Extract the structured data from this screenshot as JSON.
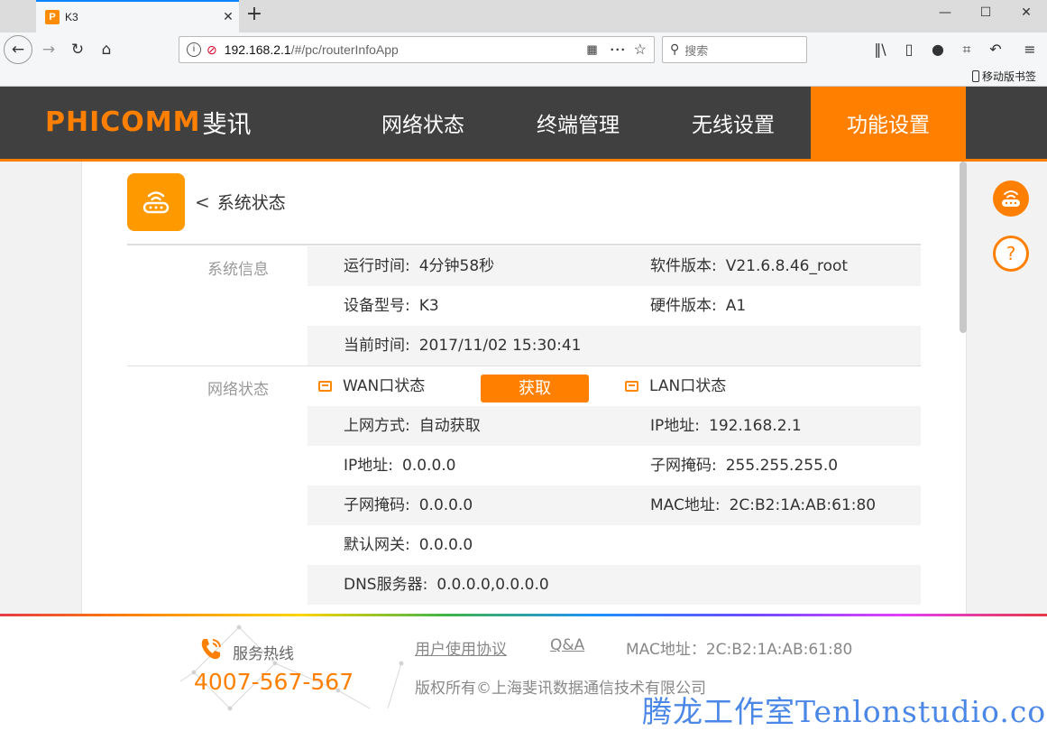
{
  "browser": {
    "tab_title": "K3",
    "tab_favicon": "P",
    "url_host": "192.168.2.1",
    "url_path": "/#/pc/routerInfoApp",
    "search_placeholder": "搜索",
    "bookmark_label": "移动版书签"
  },
  "header": {
    "logo_brand": "PHICOMM",
    "logo_cn": "斐讯",
    "nav": [
      "网络状态",
      "终端管理",
      "无线设置",
      "功能设置"
    ],
    "active_nav": "功能设置"
  },
  "page": {
    "back_title": "系统状态",
    "fetch_button": "获取"
  },
  "system_info": {
    "label": "系统信息",
    "uptime_k": "运行时间:",
    "uptime_v": "4分钟58秒",
    "sw_k": "软件版本:",
    "sw_v": "V21.6.8.46_root",
    "model_k": "设备型号:",
    "model_v": "K3",
    "hw_k": "硬件版本:",
    "hw_v": "A1",
    "time_k": "当前时间:",
    "time_v": "2017/11/02 15:30:41"
  },
  "network": {
    "label": "网络状态",
    "wan_title": "WAN口状态",
    "lan_title": "LAN口状态",
    "conn_k": "上网方式:",
    "conn_v": "自动获取",
    "lan_ip_k": "IP地址:",
    "lan_ip_v": "192.168.2.1",
    "wan_ip_k": "IP地址:",
    "wan_ip_v": "0.0.0.0",
    "lan_mask_k": "子网掩码:",
    "lan_mask_v": "255.255.255.0",
    "wan_mask_k": "子网掩码:",
    "wan_mask_v": "0.0.0.0",
    "lan_mac_k": "MAC地址:",
    "lan_mac_v": "2C:B2:1A:AB:61:80",
    "gw_k": "默认网关:",
    "gw_v": "0.0.0.0",
    "dns_k": "DNS服务器:",
    "dns_v": "0.0.0.0,0.0.0.0"
  },
  "footer": {
    "hotline_label": "服务热线",
    "hotline_number": "4007-567-567",
    "link_agreement": "用户使用协议",
    "link_qa": "Q&A",
    "mac": "MAC地址：2C:B2:1A:AB:61:80",
    "copyright": "版权所有©上海斐讯数据通信技术有限公司"
  },
  "watermark": "腾龙工作室Tenlonstudio.com",
  "colors": {
    "accent": "#ff8000",
    "header_bg": "#404040",
    "watermark": "#4b87e6"
  }
}
